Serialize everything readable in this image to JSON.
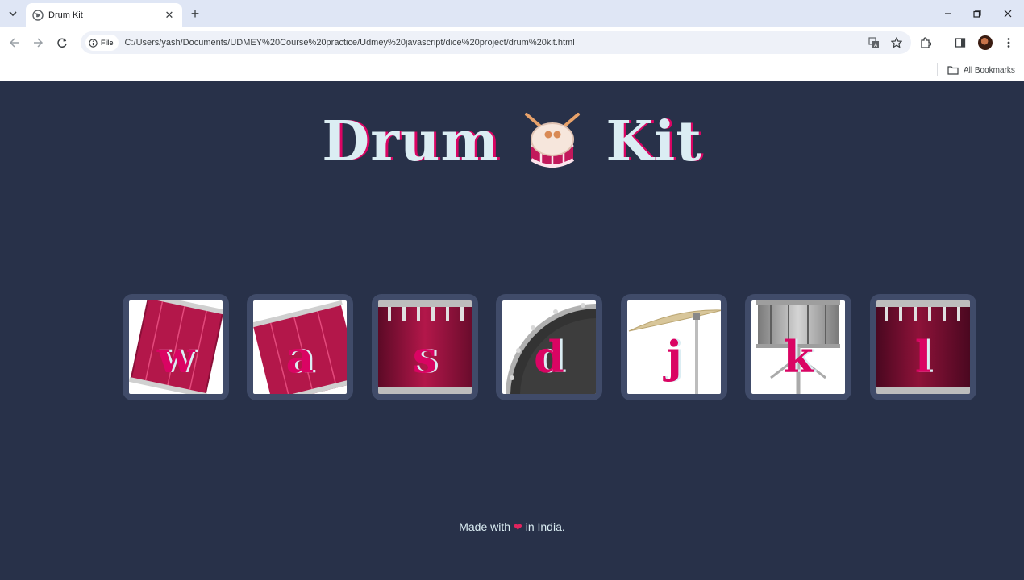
{
  "browser": {
    "tab_title": "Drum Kit",
    "url_chip": "File",
    "url": "C:/Users/yash/Documents/UDMEY%20Course%20practice/Udmey%20javascript/dice%20project/drum%20kit.html",
    "bookmarks_label": "All Bookmarks",
    "icons": [
      "tab-search-icon",
      "globe-icon",
      "close-icon",
      "plus-icon",
      "minimize-icon",
      "restore-icon",
      "close-window-icon",
      "back-icon",
      "forward-icon",
      "reload-icon",
      "info-icon",
      "translate-icon",
      "star-icon",
      "extensions-icon",
      "side-panel-icon",
      "avatar",
      "more-icon",
      "folder-icon"
    ]
  },
  "page": {
    "title_left": "Drum",
    "title_right": "Kit",
    "title_emoji": "drum-icon",
    "footer": {
      "before": "Made with",
      "heart": "❤",
      "after": "in India."
    },
    "colors": {
      "background": "#283149",
      "tile": "#404b69",
      "accent": "#da0463",
      "text": "#dbedf3"
    }
  },
  "drums": [
    {
      "key": "w",
      "name": "tom1"
    },
    {
      "key": "a",
      "name": "tom2"
    },
    {
      "key": "s",
      "name": "tom3"
    },
    {
      "key": "d",
      "name": "tom4"
    },
    {
      "key": "j",
      "name": "snare"
    },
    {
      "key": "k",
      "name": "crash"
    },
    {
      "key": "l",
      "name": "kick-bass"
    }
  ]
}
